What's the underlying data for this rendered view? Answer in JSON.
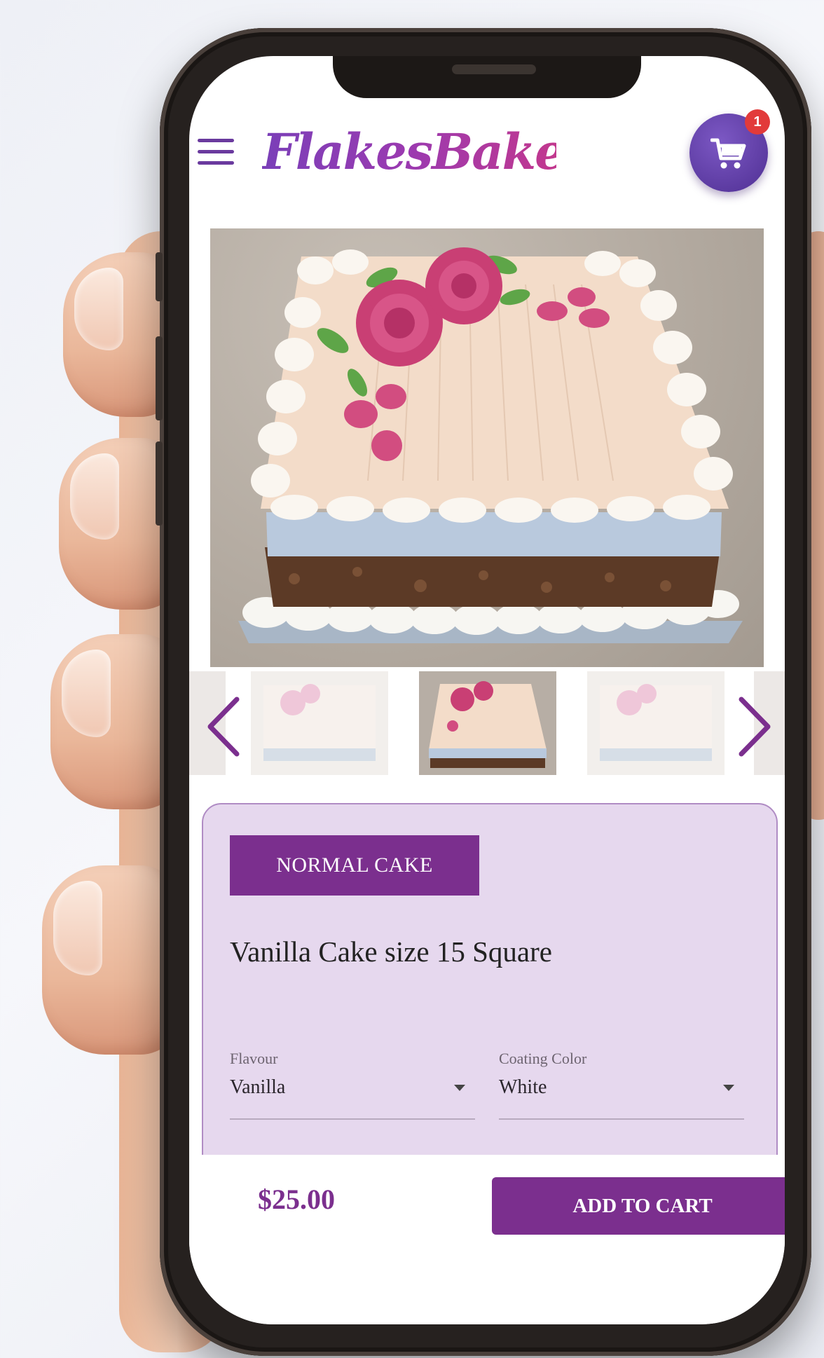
{
  "app": {
    "logo_text": "FlakesBakes",
    "cart_count": "1"
  },
  "product": {
    "category_badge": "NORMAL CAKE",
    "title": "Vanilla Cake size 15 Square",
    "price": "$25.00"
  },
  "options": {
    "flavour_label": "Flavour",
    "flavour_value": "Vanilla",
    "coating_label": "Coating Color",
    "coating_value": "White"
  },
  "actions": {
    "add_to_cart_label": "ADD TO CART"
  },
  "gallery": {
    "thumbnail_count": 5,
    "selected_index": 2
  },
  "icons": {
    "menu": "hamburger-menu-icon",
    "cart": "shopping-cart-icon",
    "prev": "chevron-left-icon",
    "next": "chevron-right-icon"
  },
  "colors": {
    "brand_purple": "#7b2f8e",
    "card_background": "#e6d8ee",
    "cart_button": "#5a3a9c",
    "badge_red": "#e23a3a"
  }
}
